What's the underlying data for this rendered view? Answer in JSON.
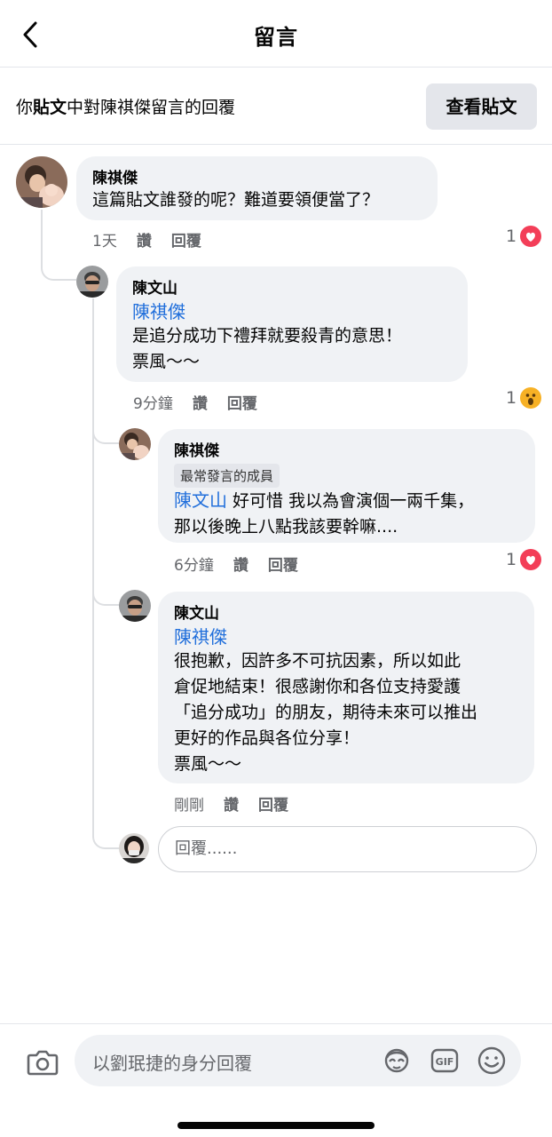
{
  "header": {
    "title": "留言"
  },
  "context": {
    "prefix": "你",
    "bold": "貼文",
    "suffix": "中對陳祺傑留言的回覆",
    "view_post_label": "查看貼文"
  },
  "comments": [
    {
      "name": "陳祺傑",
      "lines": [
        "這篇貼文誰發的呢？難道要領便當了？"
      ],
      "time": "1天",
      "like": "讚",
      "reply": "回覆",
      "reaction_count": "1",
      "reaction": "love-icon"
    },
    {
      "name": "陳文山",
      "mention": "陳祺傑",
      "lines": [
        "是追分成功下禮拜就要殺青的意思！",
        "票風～～"
      ],
      "time": "9分鐘",
      "like": "讚",
      "reply": "回覆",
      "reaction_count": "1",
      "reaction": "wow-icon"
    },
    {
      "name": "陳祺傑",
      "badge": "最常發言的成員",
      "mention": "陳文山",
      "first_line_rest": " 好可惜 我以為會演個一兩千集，",
      "lines": [
        "那以後晚上八點我該要幹嘛...."
      ],
      "time": "6分鐘",
      "like": "讚",
      "reply": "回覆",
      "reaction_count": "1",
      "reaction": "love-icon"
    },
    {
      "name": "陳文山",
      "mention": "陳祺傑",
      "lines": [
        "很抱歉，因許多不可抗因素，所以如此",
        "倉促地結束！很感謝你和各位支持愛護",
        "「追分成功」的朋友，期待未來可以推出",
        "更好的作品與各位分享！",
        "票風～～"
      ],
      "time": "剛剛",
      "like": "讚",
      "reply": "回覆"
    }
  ],
  "reply_input": {
    "placeholder": "回覆......"
  },
  "composer": {
    "placeholder": "以劉珉捷的身分回覆",
    "icons": [
      "camera-icon",
      "avatar-sticker-icon",
      "gif-icon",
      "emoji-icon"
    ]
  },
  "colors": {
    "mention": "#216fdb",
    "love": "#f33e58",
    "wow": "#f7b125"
  }
}
